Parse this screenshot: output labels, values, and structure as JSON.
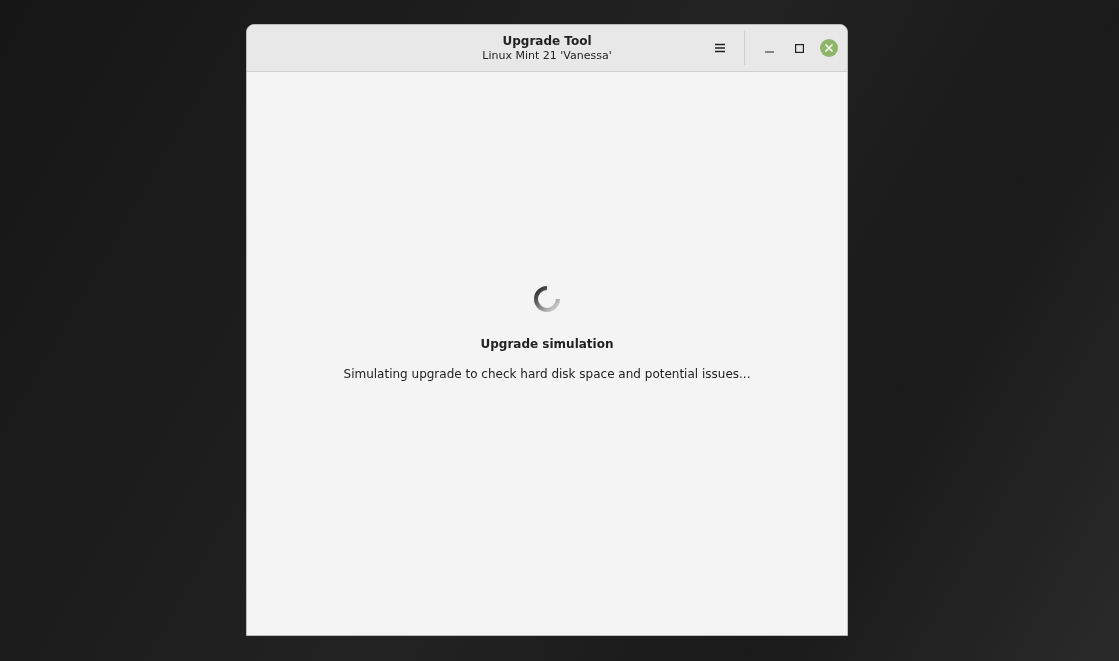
{
  "window": {
    "title": "Upgrade Tool",
    "subtitle": "Linux Mint 21 'Vanessa'"
  },
  "content": {
    "heading": "Upgrade simulation",
    "message": "Simulating upgrade to check hard disk space and potential issues..."
  }
}
